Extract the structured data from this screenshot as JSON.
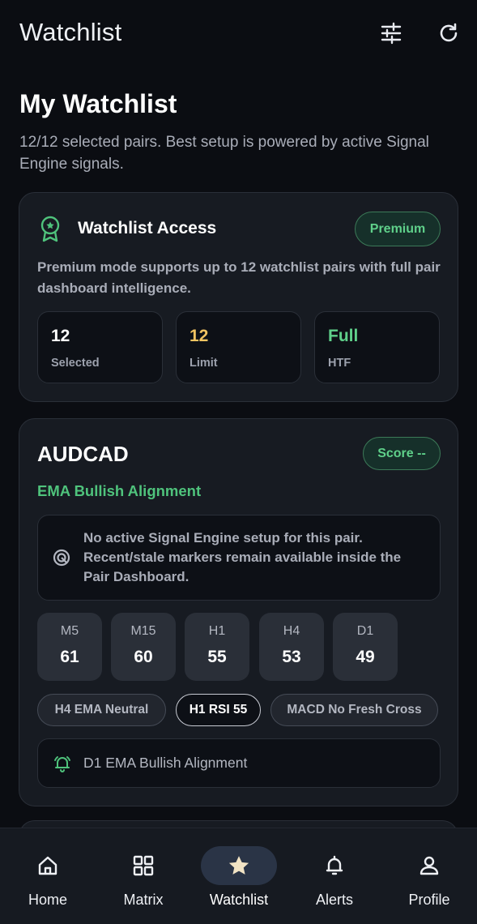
{
  "header": {
    "title": "Watchlist",
    "tune_icon": "tune-icon",
    "refresh_icon": "refresh-icon"
  },
  "page": {
    "title": "My Watchlist",
    "subtitle": "12/12 selected pairs. Best setup is powered by active Signal Engine signals."
  },
  "access": {
    "title": "Watchlist Access",
    "badge": "Premium",
    "description": "Premium mode supports up to 12 watchlist pairs with full pair dashboard intelligence.",
    "stats": [
      {
        "value": "12",
        "label": "Selected",
        "color": "#ffffff"
      },
      {
        "value": "12",
        "label": "Limit",
        "color": "#f2c462"
      },
      {
        "value": "Full",
        "label": "HTF",
        "color": "#5fd08a"
      }
    ]
  },
  "pair": {
    "name": "AUDCAD",
    "score": "Score --",
    "signal": "EMA Bullish Alignment",
    "notice": "No active Signal Engine setup for this pair. Recent/stale markers remain available inside the Pair Dashboard.",
    "timeframes": [
      {
        "label": "M5",
        "value": "61"
      },
      {
        "label": "M15",
        "value": "60"
      },
      {
        "label": "H1",
        "value": "55"
      },
      {
        "label": "H4",
        "value": "53"
      },
      {
        "label": "D1",
        "value": "49"
      }
    ],
    "chips": [
      {
        "label": "H4 EMA Neutral",
        "active": false
      },
      {
        "label": "H1 RSI 55",
        "active": true
      },
      {
        "label": "MACD No Fresh Cross",
        "active": false
      }
    ],
    "alert": "D1 EMA Bullish Alignment"
  },
  "nav": {
    "items": [
      {
        "label": "Home",
        "icon": "home-icon"
      },
      {
        "label": "Matrix",
        "icon": "grid-icon"
      },
      {
        "label": "Watchlist",
        "icon": "star-icon",
        "active": true
      },
      {
        "label": "Alerts",
        "icon": "bell-icon"
      },
      {
        "label": "Profile",
        "icon": "person-icon"
      }
    ]
  },
  "colors": {
    "background": "#0b0d12",
    "card": "#171b22",
    "accent_green": "#5fd08a",
    "accent_yellow": "#f2c462",
    "nav_active": "#2a3446"
  }
}
